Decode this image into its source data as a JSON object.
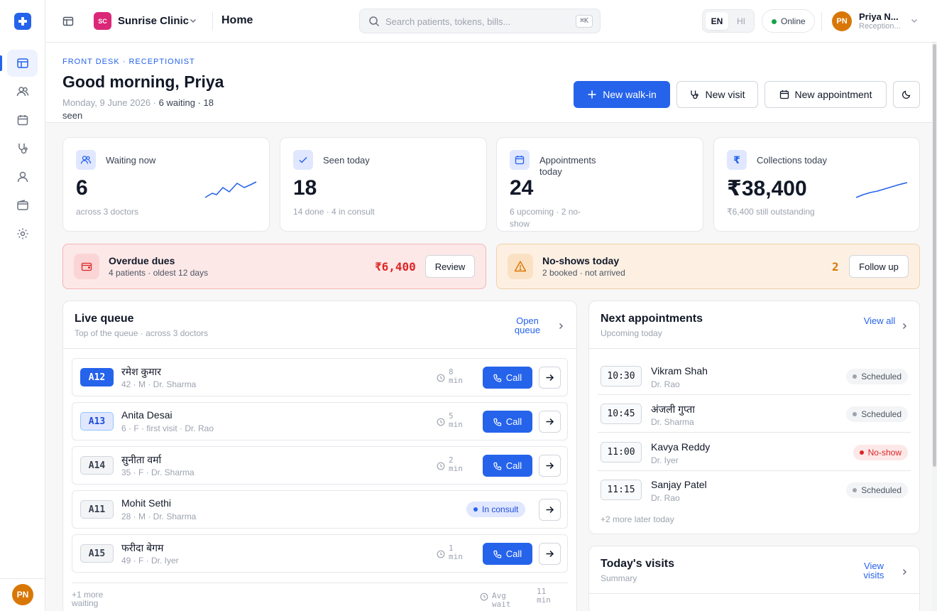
{
  "topbar": {
    "clinic_initials": "SC",
    "clinic_name": "Sunrise Clinic",
    "page_title": "Home",
    "search_placeholder": "Search patients, tokens, bills...",
    "search_shortcut": "⌘K",
    "lang_en": "EN",
    "lang_hi": "HI",
    "status": "Online",
    "user_initials": "PN",
    "user_name": "Priya N...",
    "user_role": "Reception..."
  },
  "header": {
    "eyebrow": "FRONT DESK · RECEPTIONIST",
    "greeting": "Good morning, Priya",
    "date": "Monday, 9 June 2026 · ",
    "summary": "6 waiting · 18",
    "summary_tail": "seen",
    "btn_walkin": "New walk-in",
    "btn_visit": "New visit",
    "btn_appointment": "New appointment"
  },
  "stats": [
    {
      "label": "Waiting now",
      "value": "6",
      "sub": "across 3 doctors"
    },
    {
      "label": "Seen today",
      "value": "18",
      "sub": "14 done · 4 in consult"
    },
    {
      "label": "Appointments today",
      "value": "24",
      "sub": "6 upcoming · 2 no-show"
    },
    {
      "label": "Collections today",
      "value": "₹38,400",
      "sub": "₹6,400 still outstanding"
    }
  ],
  "alerts": {
    "dues": {
      "title": "Overdue dues",
      "sub": "4 patients · oldest 12 days",
      "amount": "₹6,400",
      "action": "Review"
    },
    "noshow": {
      "title": "No-shows today",
      "sub": "2 booked · not arrived",
      "amount": "2",
      "action": "Follow up"
    }
  },
  "queue": {
    "title": "Live queue",
    "subtitle": "Top of the queue · across 3 doctors",
    "link": "Open queue",
    "call_label": "Call",
    "consult_label": "In consult",
    "rows": [
      {
        "token": "A12",
        "name": "रमेश कुमार",
        "meta": "42 · M · Dr. Sharma",
        "wait": "8 min"
      },
      {
        "token": "A13",
        "name": "Anita Desai",
        "meta": "6 · F · first visit · Dr. Rao",
        "wait": "5 min"
      },
      {
        "token": "A14",
        "name": "सुनीता वर्मा",
        "meta": "35 · F · Dr. Sharma",
        "wait": "2 min"
      },
      {
        "token": "A11",
        "name": "Mohit Sethi",
        "meta": "28 · M · Dr. Sharma",
        "wait": ""
      },
      {
        "token": "A15",
        "name": "फरीदा बेगम",
        "meta": "49 · F · Dr. Iyer",
        "wait": "1 min"
      }
    ],
    "footer_more": "+1 more waiting",
    "footer_avg_label": "Avg wait",
    "footer_avg_value": "11 min"
  },
  "appointments": {
    "title": "Next appointments",
    "subtitle": "Upcoming today",
    "link": "View all",
    "rows": [
      {
        "time": "10:30",
        "name": "Vikram Shah",
        "doctor": "Dr. Rao",
        "status": "Scheduled"
      },
      {
        "time": "10:45",
        "name": "अंजली गुप्ता",
        "doctor": "Dr. Sharma",
        "status": "Scheduled"
      },
      {
        "time": "11:00",
        "name": "Kavya Reddy",
        "doctor": "Dr. Iyer",
        "status": "No-show"
      },
      {
        "time": "11:15",
        "name": "Sanjay Patel",
        "doctor": "Dr. Rao",
        "status": "Scheduled"
      }
    ],
    "more": "+2 more later today"
  },
  "visits": {
    "title": "Today's visits",
    "subtitle": "Summary",
    "link": "View visits"
  },
  "colors": {
    "accent": "#2563eb",
    "danger": "#dc2626",
    "warning": "#d97706",
    "online": "#16a34a"
  }
}
